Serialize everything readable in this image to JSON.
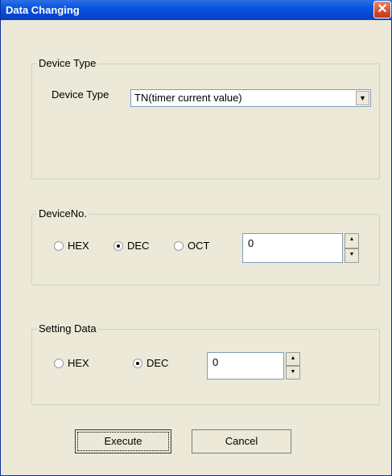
{
  "window": {
    "title": "Data Changing"
  },
  "device_type_group": {
    "label": "Device Type",
    "field_label": "Device Type",
    "selected": "TN(timer current value)"
  },
  "device_no_group": {
    "label": "DeviceNo.",
    "radio_hex": "HEX",
    "radio_dec": "DEC",
    "radio_oct": "OCT",
    "selected": "DEC",
    "value": "0"
  },
  "setting_data_group": {
    "label": "Setting Data",
    "radio_hex": "HEX",
    "radio_dec": "DEC",
    "selected": "DEC",
    "value": "0"
  },
  "buttons": {
    "execute": "Execute",
    "cancel": "Cancel"
  },
  "icons": {
    "close": "close-icon",
    "dropdown": "chevron-down-icon",
    "spin_up": "arrow-up-icon",
    "spin_down": "arrow-down-icon"
  }
}
